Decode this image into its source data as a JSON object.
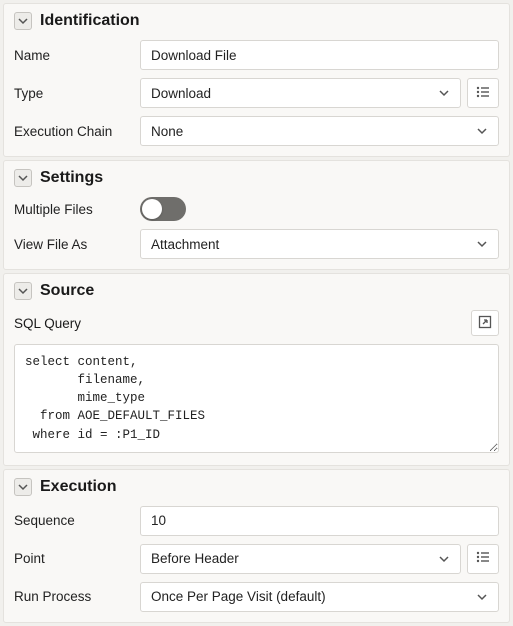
{
  "sections": {
    "identification": {
      "title": "Identification",
      "name": {
        "label": "Name",
        "value": "Download File"
      },
      "type": {
        "label": "Type",
        "value": "Download"
      },
      "execution_chain": {
        "label": "Execution Chain",
        "value": "None"
      }
    },
    "settings": {
      "title": "Settings",
      "multiple_files": {
        "label": "Multiple Files",
        "on": false
      },
      "view_file_as": {
        "label": "View File As",
        "value": "Attachment"
      }
    },
    "source": {
      "title": "Source",
      "sql_query": {
        "label": "SQL Query",
        "value": "select content,\n       filename,\n       mime_type\n  from AOE_DEFAULT_FILES\n where id = :P1_ID"
      }
    },
    "execution": {
      "title": "Execution",
      "sequence": {
        "label": "Sequence",
        "value": "10"
      },
      "point": {
        "label": "Point",
        "value": "Before Header"
      },
      "run_process": {
        "label": "Run Process",
        "value": "Once Per Page Visit (default)"
      }
    }
  }
}
